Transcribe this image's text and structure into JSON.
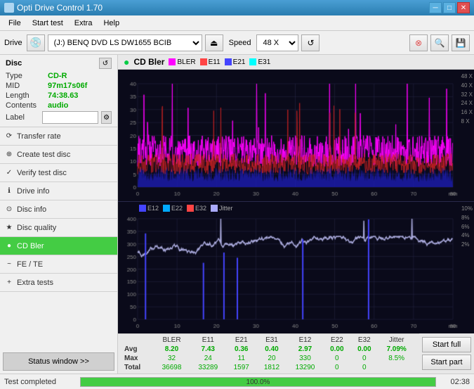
{
  "titleBar": {
    "title": "Opti Drive Control 1.70",
    "icon": "disc-icon"
  },
  "menuBar": {
    "items": [
      "File",
      "Start test",
      "Extra",
      "Help"
    ]
  },
  "toolbar": {
    "driveLabel": "Drive",
    "driveValue": "(J:)  BENQ DVD LS DW1655 BCIB",
    "speedLabel": "Speed",
    "speedValue": "48 X"
  },
  "discPanel": {
    "title": "Disc",
    "type": {
      "label": "Type",
      "value": "CD-R"
    },
    "mid": {
      "label": "MID",
      "value": "97m17s06f"
    },
    "length": {
      "label": "Length",
      "value": "74:38.63"
    },
    "contents": {
      "label": "Contents",
      "value": "audio"
    },
    "label": {
      "label": "Label",
      "value": ""
    }
  },
  "sidebar": {
    "items": [
      {
        "id": "transfer-rate",
        "label": "Transfer rate",
        "icon": "⟳"
      },
      {
        "id": "create-test-disc",
        "label": "Create test disc",
        "icon": "⊕"
      },
      {
        "id": "verify-test-disc",
        "label": "Verify test disc",
        "icon": "✓"
      },
      {
        "id": "drive-info",
        "label": "Drive info",
        "icon": "ℹ"
      },
      {
        "id": "disc-info",
        "label": "Disc info",
        "icon": "⊙"
      },
      {
        "id": "disc-quality",
        "label": "Disc quality",
        "icon": "★"
      },
      {
        "id": "cd-bler",
        "label": "CD Bler",
        "icon": "●",
        "active": true
      },
      {
        "id": "fe-te",
        "label": "FE / TE",
        "icon": "~"
      },
      {
        "id": "extra-tests",
        "label": "Extra tests",
        "icon": "+"
      }
    ],
    "statusWindowBtn": "Status window >>"
  },
  "chart": {
    "title": "CD Bler",
    "icon": "●",
    "legend1": [
      "BLER",
      "E11",
      "E21",
      "E31"
    ],
    "legend2": [
      "E12",
      "E22",
      "E32",
      "Jitter"
    ],
    "legend1Colors": [
      "#ff00ff",
      "#ff4444",
      "#4444ff",
      "#00ffff"
    ],
    "legend2Colors": [
      "#4444ff",
      "#00aaff",
      "#ff4444",
      "#aaaaff"
    ]
  },
  "stats": {
    "headers": [
      "",
      "BLER",
      "E11",
      "E21",
      "E31",
      "E12",
      "E22",
      "E32",
      "Jitter"
    ],
    "avg": {
      "label": "Avg",
      "values": [
        "8.20",
        "7.43",
        "0.36",
        "0.40",
        "2.97",
        "0.00",
        "0.00",
        "7.09%"
      ]
    },
    "max": {
      "label": "Max",
      "values": [
        "32",
        "24",
        "11",
        "20",
        "330",
        "0",
        "0",
        "8.5%"
      ]
    },
    "total": {
      "label": "Total",
      "values": [
        "36698",
        "33289",
        "1597",
        "1812",
        "13290",
        "0",
        "0",
        ""
      ]
    }
  },
  "buttons": {
    "startFull": "Start full",
    "startPart": "Start part"
  },
  "statusBar": {
    "text": "Test completed",
    "progress": 100.0,
    "progressText": "100.0%",
    "time": "02:38"
  }
}
